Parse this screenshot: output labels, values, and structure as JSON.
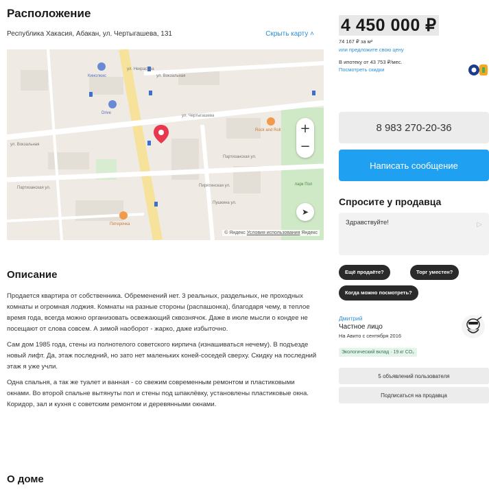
{
  "location": {
    "title": "Расположение",
    "address": "Республика Хакасия, Абакан, ул. Чертыгашева, 131",
    "hide_map": "Скрыть карту",
    "map_footer_copyright": "© Яндекс",
    "map_footer_terms": "Условия использования",
    "map_brand": "Яндекс",
    "map_labels": {
      "street_1": "ул. Вокзальная",
      "street_2": "ул. Вокзальная",
      "street_3": "ул. Чертыгашева",
      "street_4": "Партизанская ул.",
      "street_5": "Партизанская ул.",
      "street_6": "Пушкина ул.",
      "street_7": "ул. Некрасова",
      "street_8": "Пирятинская ул.",
      "poi_1": "Кинолюкс",
      "poi_2": "Drive",
      "poi_3": "Rock and Roll",
      "poi_4": "Пятерочка",
      "poi_5": "парк Пол"
    },
    "zoom_in": "+",
    "zoom_out": "−",
    "locate": "➤"
  },
  "description": {
    "title": "Описание",
    "paragraphs": [
      "Продается квартира от собственника. Обременений нет. 3 реальных, раздельных, не проходных комнаты и огромная лоджия. Комнаты на разные стороны (распашонка), благодаря чему, в теплое время года, всегда можно организовать освежающий сквознячок. Даже в июле мысли о кондее не посещают от слова совсем. А зимой наоборот - жарко, даже избыточно.",
      "Сам дом 1985 года, стены из полнотелого советского кирпича (изнашиваться нечему). В подъезде новый лифт. Да, этаж последний, но зато нет маленьких коней-соседей сверху. Скидку на последний этаж я уже учли.",
      "Одна спальня, а так же туалет и ванная - со свежим современным ремонтом и пластиковыми окнами. Во второй спальне вытянуты пол и стены под шпаклёвку, установлены пластиковые окна. Коридор, зал и кухня с советским ремонтом и деревянными окнами."
    ]
  },
  "about_house": {
    "title": "О доме"
  },
  "price": {
    "value": "4 450 000 ₽",
    "per_sqm": "74 167 ₽ за м²",
    "offer_link": "или предложите свою цену",
    "mortgage": "В ипотеку от 43 753 ₽/мес.",
    "discount_link": "Посмотреть скидки"
  },
  "contacts": {
    "phone": "8 983 270-20-36",
    "message_button": "Написать сообщение"
  },
  "ask_seller": {
    "title": "Спросите у продавца",
    "message": "Здравствуйте!",
    "send_icon": "send-arrow",
    "chips": [
      "Ещё продаёте?",
      "Торг уместен?",
      "Когда можно посмотреть?"
    ]
  },
  "seller": {
    "name": "Дмитрий",
    "type": "Частное лицо",
    "since": "На Авито с сентября 2016",
    "eco_badge": "Экологический вклад · 19 кг CO₂",
    "listings_button": "5 объявлений пользователя",
    "subscribe_button": "Подписаться на продавца"
  },
  "colors": {
    "accent_blue": "#20a0f0",
    "link_blue": "#2b8fd9",
    "chip_dark": "#2a2a2a",
    "map_pin": "#e8384f"
  }
}
